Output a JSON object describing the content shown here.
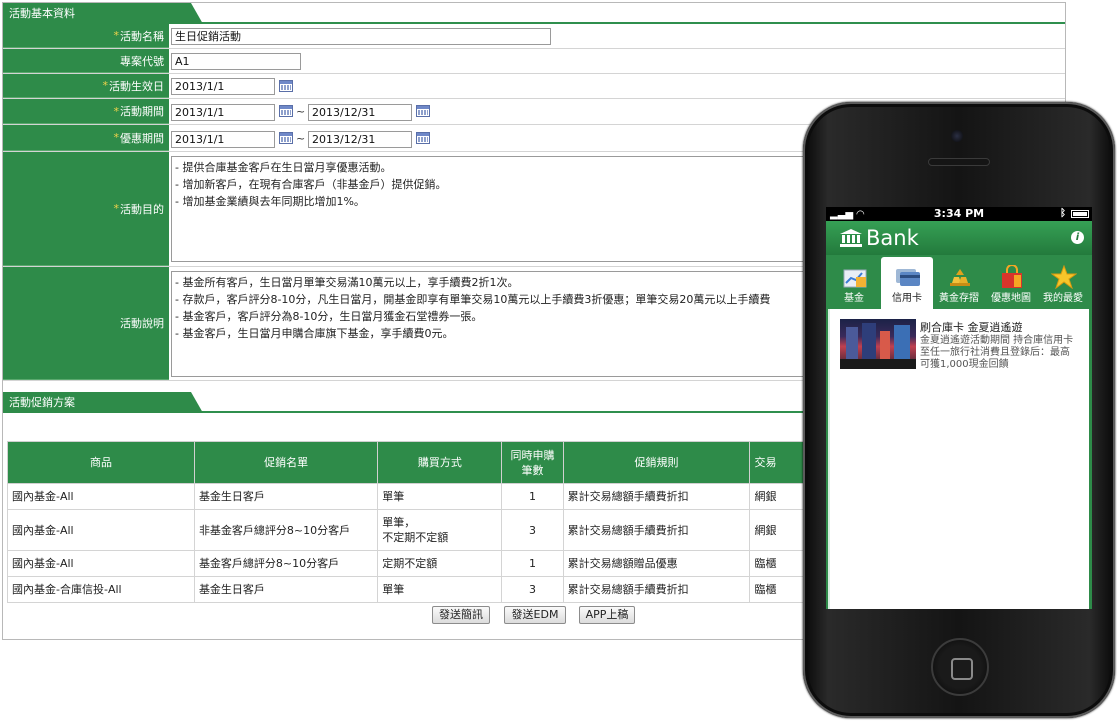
{
  "colors": {
    "primary_green": "#2e8b49",
    "required_star": "#f0d24a"
  },
  "section_basic": {
    "title": "活動基本資料"
  },
  "form": {
    "required_mark": "*",
    "name": {
      "label": "活動名稱",
      "value": "生日促銷活動"
    },
    "code": {
      "label": "專案代號",
      "value": "A1"
    },
    "effective": {
      "label": "活動生效日",
      "value": "2013/1/1"
    },
    "period": {
      "label": "活動期間",
      "start": "2013/1/1",
      "end": "2013/12/31"
    },
    "discount": {
      "label": "優惠期間",
      "start": "2013/1/1",
      "end": "2013/12/31"
    },
    "range_sep": "~",
    "purpose": {
      "label": "活動目的",
      "lines": [
        "- 提供合庫基金客戶在生日當月享優惠活動。",
        "- 增加新客戶，在現有合庫客戶（非基金戶）提供促銷。",
        "- 增加基金業績與去年同期比增加1%。"
      ]
    },
    "description": {
      "label": "活動說明",
      "lines": [
        "- 基金所有客戶，生日當月單筆交易滿10萬元以上，享手續費2折1次。",
        "- 存款戶，客戶評分8-10分，凡生日當月，開基金即享有單筆交易10萬元以上手續費3折優惠；單筆交易20萬元以上手續費",
        "- 基金客戶，客戶評分為8-10分，生日當月獲金石堂禮券一張。",
        "- 基金客戶，生日當月申購合庫旗下基金，享手續費0元。"
      ]
    }
  },
  "section_promo": {
    "title": "活動促銷方案"
  },
  "table": {
    "headers": [
      "商品",
      "促銷名單",
      "購買方式",
      "同時申購\n筆數",
      "促銷規則",
      "交易"
    ],
    "rows": [
      [
        "國內基金-All",
        "基金生日客戶",
        "單筆",
        "1",
        "累計交易總額手續費折扣",
        "網銀"
      ],
      [
        "國內基金-All",
        "非基金客戶總評分8~10分客戶",
        "單筆，\n不定期不定額",
        "3",
        "累計交易總額手續費折扣",
        "網銀"
      ],
      [
        "國內基金-All",
        "基金客戶總評分8~10分客戶",
        "定期不定額",
        "1",
        "累計交易總額贈品優惠",
        "臨櫃"
      ],
      [
        "國內基金-合庫信投-All",
        "基金生日客戶",
        "單筆",
        "3",
        "累計交易總額手續費折扣",
        "臨櫃"
      ]
    ]
  },
  "buttons": {
    "sms": "發送簡訊",
    "edm": "發送EDM",
    "app": "APP上稿"
  },
  "phone": {
    "time": "3:34 PM",
    "app_title": "Bank",
    "info_glyph": "i",
    "tabs": [
      {
        "label": "基金",
        "icon": "fund-chart-icon"
      },
      {
        "label": "信用卡",
        "icon": "credit-card-icon"
      },
      {
        "label": "黃金存摺",
        "icon": "gold-bars-icon"
      },
      {
        "label": "優惠地圖",
        "icon": "shopping-bag-icon"
      },
      {
        "label": "我的最愛",
        "icon": "star-icon"
      }
    ],
    "active_tab": 1,
    "news": {
      "title": "刷合庫卡 金夏逍遙遊",
      "body_lines": [
        "金夏逍遙遊活動期間 持合庫信用卡",
        "至任一旅行社消費且登錄后：最高",
        "可獲1,000現金回饋"
      ]
    }
  }
}
